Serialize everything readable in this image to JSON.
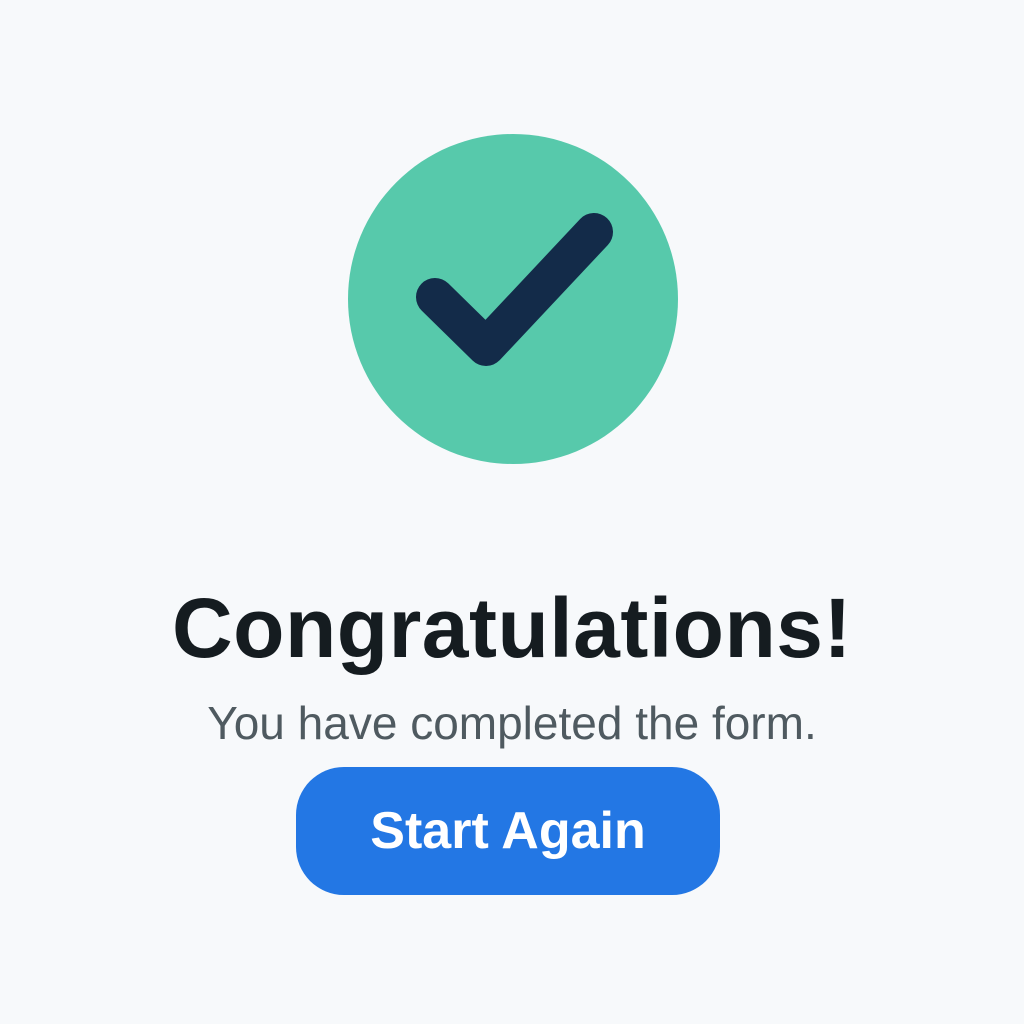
{
  "colors": {
    "background": "#f7f9fb",
    "success_circle": "#57c9ab",
    "checkmark": "#132b49",
    "title_text": "#151c20",
    "subtitle_text": "#4f5a60",
    "button_background": "#2377e4",
    "button_text": "#ffffff"
  },
  "success": {
    "icon": "check-icon"
  },
  "content": {
    "title": "Congratulations!",
    "subtitle": "You have completed the form."
  },
  "actions": {
    "start_again_label": "Start Again"
  }
}
